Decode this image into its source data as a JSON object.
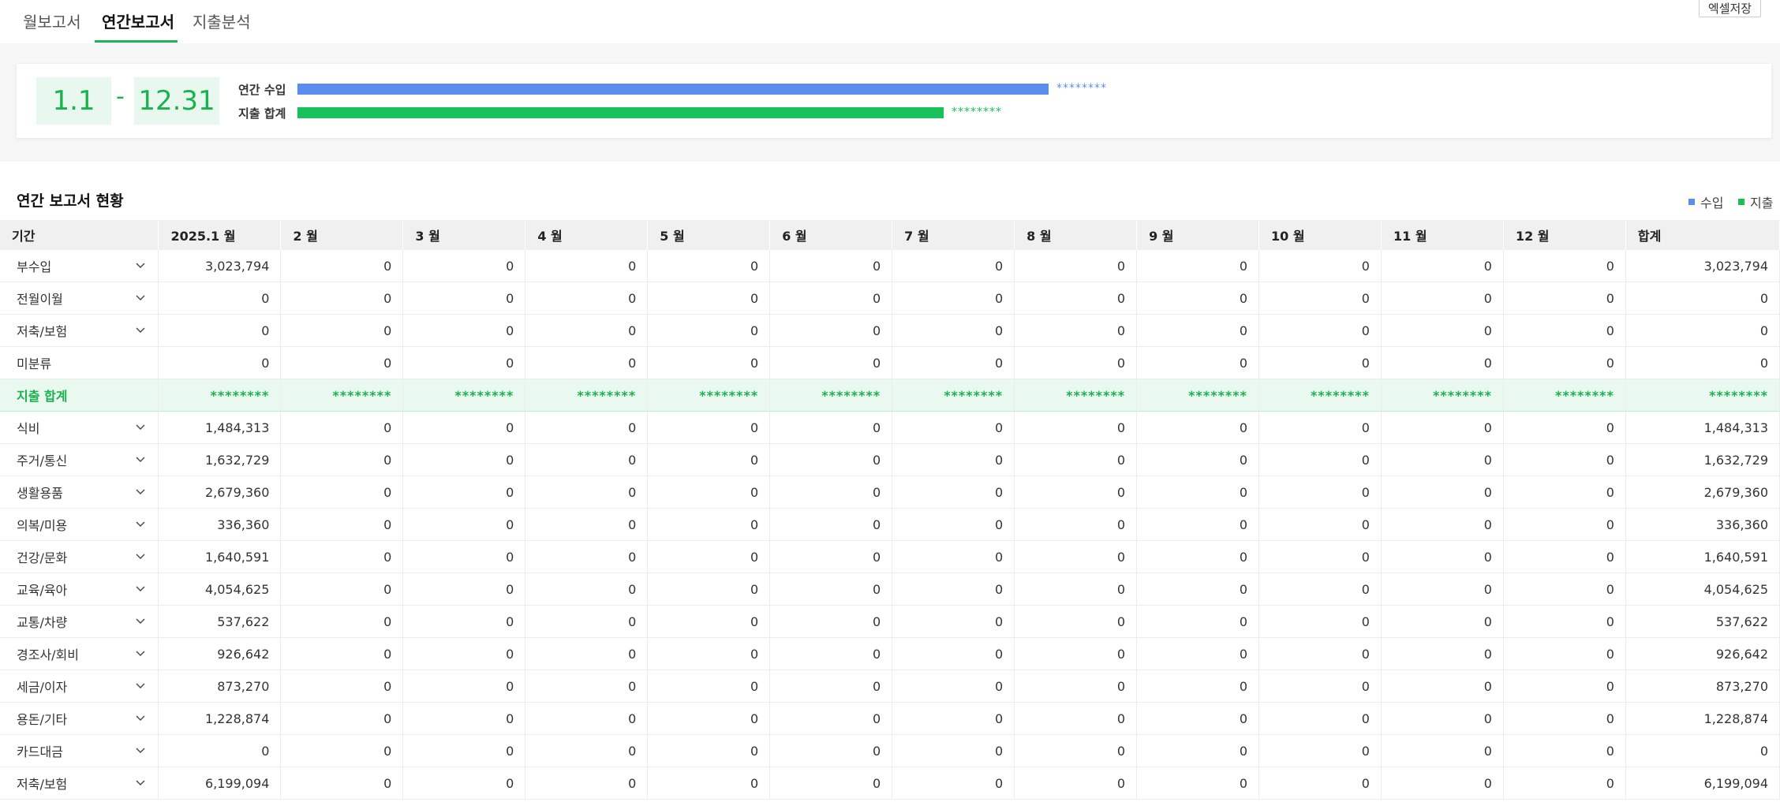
{
  "tabs": [
    {
      "label": "월보고서",
      "active": false
    },
    {
      "label": "연간보고서",
      "active": true
    },
    {
      "label": "지출분석",
      "active": false
    }
  ],
  "excel_button": "엑셀저장",
  "summary": {
    "date_start": "1.1",
    "date_sep": "-",
    "date_end": "12.31",
    "income_label": "연간 수입",
    "income_value": "********",
    "income_fraction": 0.68,
    "expense_label": "지출 합계",
    "expense_value": "********",
    "expense_fraction": 0.585
  },
  "section_title": "연간 보고서 현황",
  "legend": [
    {
      "label": "수입",
      "color": "#5b8def"
    },
    {
      "label": "지출",
      "color": "#19c15a"
    }
  ],
  "colors": {
    "income": "#5b8def",
    "expense": "#19c15a",
    "accent": "#1fb35a"
  },
  "table": {
    "headers": [
      "기간",
      "2025.1 월",
      "2 월",
      "3 월",
      "4 월",
      "5 월",
      "6 월",
      "7 월",
      "8 월",
      "9 월",
      "10 월",
      "11 월",
      "12 월",
      "합계"
    ],
    "rows": [
      {
        "label": "부수입",
        "expandable": true,
        "values": [
          "3,023,794",
          "0",
          "0",
          "0",
          "0",
          "0",
          "0",
          "0",
          "0",
          "0",
          "0",
          "0",
          "3,023,794"
        ]
      },
      {
        "label": "전월이월",
        "expandable": true,
        "values": [
          "0",
          "0",
          "0",
          "0",
          "0",
          "0",
          "0",
          "0",
          "0",
          "0",
          "0",
          "0",
          "0"
        ]
      },
      {
        "label": "저축/보험",
        "expandable": true,
        "values": [
          "0",
          "0",
          "0",
          "0",
          "0",
          "0",
          "0",
          "0",
          "0",
          "0",
          "0",
          "0",
          "0"
        ]
      },
      {
        "label": "미분류",
        "expandable": false,
        "values": [
          "0",
          "0",
          "0",
          "0",
          "0",
          "0",
          "0",
          "0",
          "0",
          "0",
          "0",
          "0",
          "0"
        ]
      },
      {
        "label": "지출 합계",
        "total": true,
        "values": [
          "********",
          "********",
          "********",
          "********",
          "********",
          "********",
          "********",
          "********",
          "********",
          "********",
          "********",
          "********",
          "********"
        ]
      },
      {
        "label": "식비",
        "expandable": true,
        "values": [
          "1,484,313",
          "0",
          "0",
          "0",
          "0",
          "0",
          "0",
          "0",
          "0",
          "0",
          "0",
          "0",
          "1,484,313"
        ]
      },
      {
        "label": "주거/통신",
        "expandable": true,
        "values": [
          "1,632,729",
          "0",
          "0",
          "0",
          "0",
          "0",
          "0",
          "0",
          "0",
          "0",
          "0",
          "0",
          "1,632,729"
        ]
      },
      {
        "label": "생활용품",
        "expandable": true,
        "values": [
          "2,679,360",
          "0",
          "0",
          "0",
          "0",
          "0",
          "0",
          "0",
          "0",
          "0",
          "0",
          "0",
          "2,679,360"
        ]
      },
      {
        "label": "의복/미용",
        "expandable": true,
        "values": [
          "336,360",
          "0",
          "0",
          "0",
          "0",
          "0",
          "0",
          "0",
          "0",
          "0",
          "0",
          "0",
          "336,360"
        ]
      },
      {
        "label": "건강/문화",
        "expandable": true,
        "values": [
          "1,640,591",
          "0",
          "0",
          "0",
          "0",
          "0",
          "0",
          "0",
          "0",
          "0",
          "0",
          "0",
          "1,640,591"
        ]
      },
      {
        "label": "교육/육아",
        "expandable": true,
        "values": [
          "4,054,625",
          "0",
          "0",
          "0",
          "0",
          "0",
          "0",
          "0",
          "0",
          "0",
          "0",
          "0",
          "4,054,625"
        ]
      },
      {
        "label": "교통/차량",
        "expandable": true,
        "values": [
          "537,622",
          "0",
          "0",
          "0",
          "0",
          "0",
          "0",
          "0",
          "0",
          "0",
          "0",
          "0",
          "537,622"
        ]
      },
      {
        "label": "경조사/회비",
        "expandable": true,
        "values": [
          "926,642",
          "0",
          "0",
          "0",
          "0",
          "0",
          "0",
          "0",
          "0",
          "0",
          "0",
          "0",
          "926,642"
        ]
      },
      {
        "label": "세금/이자",
        "expandable": true,
        "values": [
          "873,270",
          "0",
          "0",
          "0",
          "0",
          "0",
          "0",
          "0",
          "0",
          "0",
          "0",
          "0",
          "873,270"
        ]
      },
      {
        "label": "용돈/기타",
        "expandable": true,
        "values": [
          "1,228,874",
          "0",
          "0",
          "0",
          "0",
          "0",
          "0",
          "0",
          "0",
          "0",
          "0",
          "0",
          "1,228,874"
        ]
      },
      {
        "label": "카드대금",
        "expandable": true,
        "values": [
          "0",
          "0",
          "0",
          "0",
          "0",
          "0",
          "0",
          "0",
          "0",
          "0",
          "0",
          "0",
          "0"
        ]
      },
      {
        "label": "저축/보험",
        "expandable": true,
        "values": [
          "6,199,094",
          "0",
          "0",
          "0",
          "0",
          "0",
          "0",
          "0",
          "0",
          "0",
          "0",
          "0",
          "6,199,094"
        ]
      }
    ]
  }
}
